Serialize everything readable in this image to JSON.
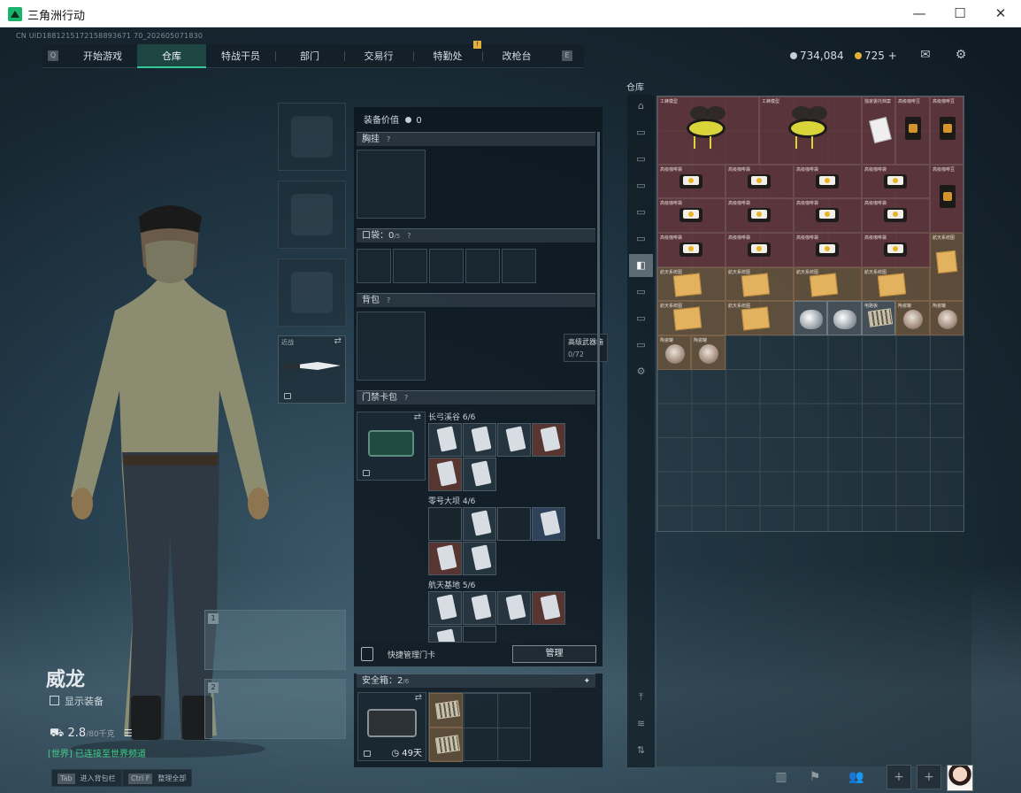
{
  "window": {
    "title": "三角洲行动"
  },
  "uid": "CN UID1881215172158893671 70_202605071830",
  "nav": {
    "left_key": "Q",
    "right_key": "E",
    "tabs": [
      "开始游戏",
      "仓库",
      "特战干员",
      "部门",
      "交易行",
      "特勤处",
      "改枪台"
    ],
    "active_tab": "仓库",
    "badge": "!"
  },
  "currency": {
    "silver": "734,084",
    "gold": "725 +"
  },
  "character": {
    "name": "威龙",
    "show_gear_label": "显示装备",
    "weight_value": "2.8",
    "weight_max": "/80千克",
    "world_chat": "[世界] 已连接至世界频道"
  },
  "hints": [
    {
      "key": "Tab",
      "label": "进入背包栏"
    },
    {
      "key": "Ctrl F",
      "label": "整理全部"
    }
  ],
  "slots": {
    "melee_label": "近战",
    "gun_slot_1": "1",
    "gun_slot_2": "2"
  },
  "loadout": {
    "value_label": "装备价值",
    "value": "0",
    "chest_rig": "胸挂",
    "pocket": "口袋：",
    "pocket_count": "0",
    "pocket_max": "/5",
    "backpack": "背包",
    "keycard_case": "门禁卡包",
    "tooltip_title": "高级武器箱",
    "tooltip_value": "0/72",
    "maps": [
      {
        "name": "长弓溪谷",
        "count": "6/6"
      },
      {
        "name": "零号大坝",
        "count": "4/6"
      },
      {
        "name": "航天基地",
        "count": "5/6"
      }
    ],
    "quick_manage": "快捷管理门卡",
    "manage_button": "管理",
    "safebox_label": "安全箱：",
    "safebox_count": "2",
    "safebox_max": "/6",
    "safebox_timer": "49天"
  },
  "storage": {
    "label": "仓库",
    "item_labels": {
      "bee": "工蜂模型",
      "folder": "独家委托档案",
      "coffee": "高级咖啡豆",
      "gift_bag": "高级咖啡袋",
      "paper": "航天系统图",
      "map": "航天系统图",
      "glass": "玻璃碎片",
      "box": "电路板",
      "jar": "陶瓷罐"
    }
  },
  "colors": {
    "accent": "#34c79a",
    "item_red": "#6e373c",
    "item_tan": "#785a3c"
  }
}
